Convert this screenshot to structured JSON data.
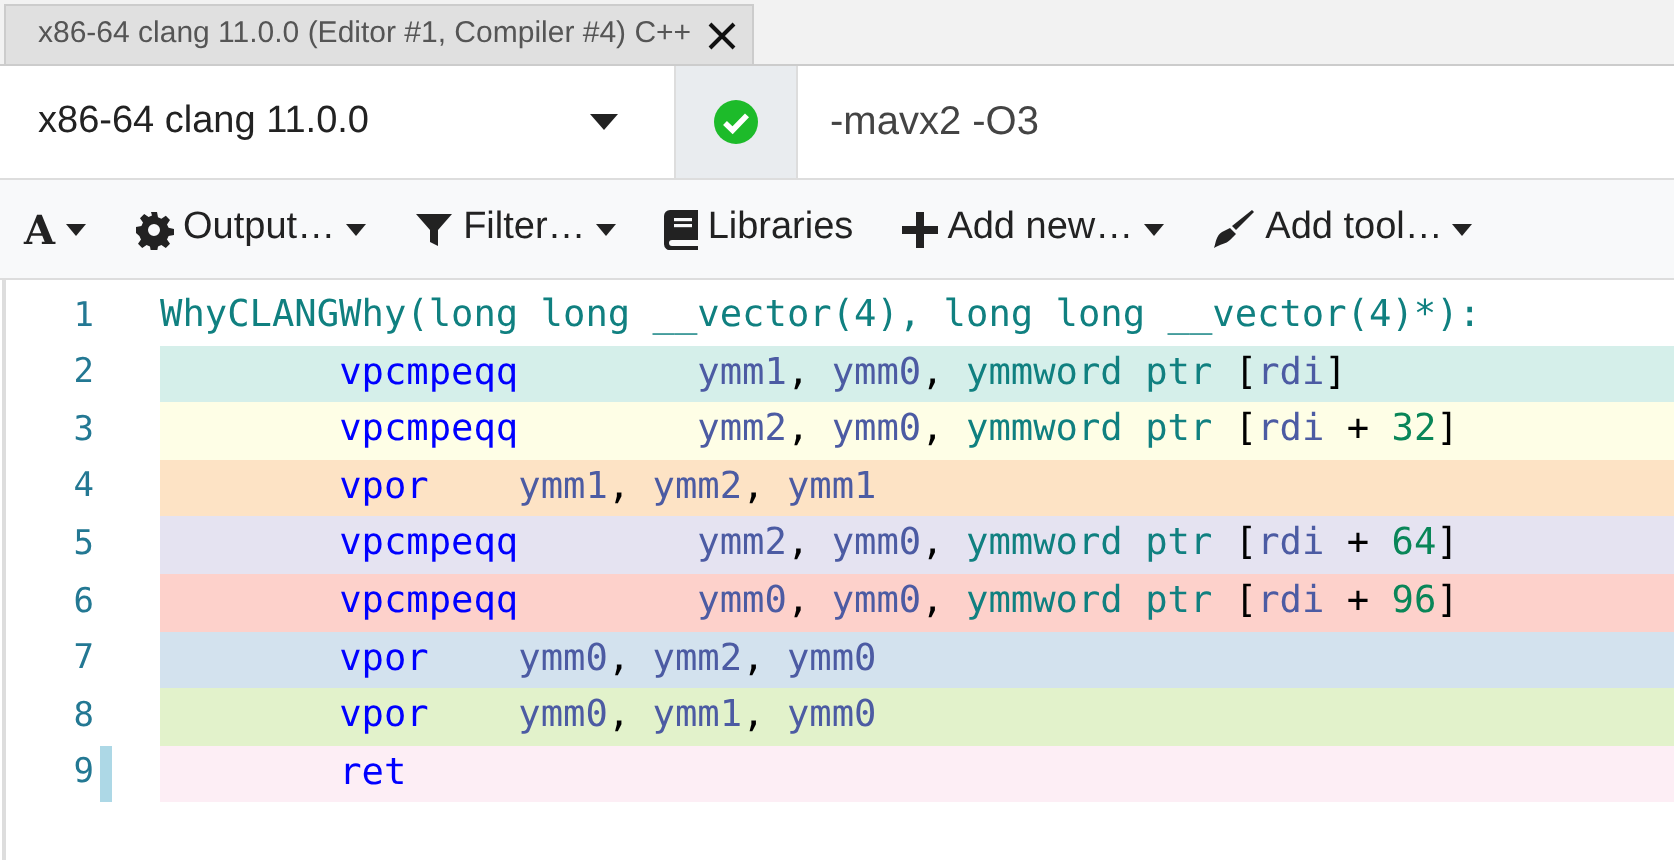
{
  "tab": {
    "title": "x86-64 clang 11.0.0 (Editor #1, Compiler #4) C++",
    "selected": true
  },
  "compiler": {
    "name": "x86-64 clang 11.0.0",
    "succeeded": true,
    "options": "-mavx2 -O3"
  },
  "toolbar": [
    {
      "kind": "font",
      "label": "A",
      "dropdown": true
    },
    {
      "kind": "output",
      "label": "Output…",
      "dropdown": true
    },
    {
      "kind": "filter",
      "label": "Filter…",
      "dropdown": true
    },
    {
      "kind": "libraries",
      "label": "Libraries",
      "dropdown": false
    },
    {
      "kind": "add",
      "label": "Add new…",
      "dropdown": true
    },
    {
      "kind": "tool",
      "label": "Add tool…",
      "dropdown": true
    }
  ],
  "lines": [
    {
      "number": "1",
      "color": "#ffffff",
      "marked": false,
      "label": "WhyCLANGWhy(long long __vector(4), long long __vector(4)*):"
    },
    {
      "number": "2",
      "color": "#d5efea",
      "marked": false,
      "mnemonic": "vpcmpeqq",
      "operands": [
        {
          "kind": "register",
          "text": "ymm1"
        },
        {
          "kind": "punct",
          "text": ", "
        },
        {
          "kind": "register",
          "text": "ymm0"
        },
        {
          "kind": "punct",
          "text": ", "
        },
        {
          "kind": "keyword",
          "text": "ymmword ptr "
        },
        {
          "kind": "punct",
          "text": "["
        },
        {
          "kind": "register",
          "text": "rdi"
        },
        {
          "kind": "punct",
          "text": "]"
        }
      ]
    },
    {
      "number": "3",
      "color": "#fefee6",
      "marked": false,
      "mnemonic": "vpcmpeqq",
      "operands": [
        {
          "kind": "register",
          "text": "ymm2"
        },
        {
          "kind": "punct",
          "text": ", "
        },
        {
          "kind": "register",
          "text": "ymm0"
        },
        {
          "kind": "punct",
          "text": ", "
        },
        {
          "kind": "keyword",
          "text": "ymmword ptr "
        },
        {
          "kind": "punct",
          "text": "["
        },
        {
          "kind": "register",
          "text": "rdi"
        },
        {
          "kind": "punct",
          "text": " + "
        },
        {
          "kind": "number",
          "text": "32"
        },
        {
          "kind": "punct",
          "text": "]"
        }
      ]
    },
    {
      "number": "4",
      "color": "#fde3c5",
      "marked": false,
      "mnemonic": "vpor",
      "operands": [
        {
          "kind": "register",
          "text": "ymm1"
        },
        {
          "kind": "punct",
          "text": ", "
        },
        {
          "kind": "register",
          "text": "ymm2"
        },
        {
          "kind": "punct",
          "text": ", "
        },
        {
          "kind": "register",
          "text": "ymm1"
        }
      ]
    },
    {
      "number": "5",
      "color": "#e5e3f1",
      "marked": false,
      "mnemonic": "vpcmpeqq",
      "operands": [
        {
          "kind": "register",
          "text": "ymm2"
        },
        {
          "kind": "punct",
          "text": ", "
        },
        {
          "kind": "register",
          "text": "ymm0"
        },
        {
          "kind": "punct",
          "text": ", "
        },
        {
          "kind": "keyword",
          "text": "ymmword ptr "
        },
        {
          "kind": "punct",
          "text": "["
        },
        {
          "kind": "register",
          "text": "rdi"
        },
        {
          "kind": "punct",
          "text": " + "
        },
        {
          "kind": "number",
          "text": "64"
        },
        {
          "kind": "punct",
          "text": "]"
        }
      ]
    },
    {
      "number": "6",
      "color": "#fdd1cb",
      "marked": false,
      "mnemonic": "vpcmpeqq",
      "operands": [
        {
          "kind": "register",
          "text": "ymm0"
        },
        {
          "kind": "punct",
          "text": ", "
        },
        {
          "kind": "register",
          "text": "ymm0"
        },
        {
          "kind": "punct",
          "text": ", "
        },
        {
          "kind": "keyword",
          "text": "ymmword ptr "
        },
        {
          "kind": "punct",
          "text": "["
        },
        {
          "kind": "register",
          "text": "rdi"
        },
        {
          "kind": "punct",
          "text": " + "
        },
        {
          "kind": "number",
          "text": "96"
        },
        {
          "kind": "punct",
          "text": "]"
        }
      ]
    },
    {
      "number": "7",
      "color": "#d3e2ee",
      "marked": false,
      "mnemonic": "vpor",
      "operands": [
        {
          "kind": "register",
          "text": "ymm0"
        },
        {
          "kind": "punct",
          "text": ", "
        },
        {
          "kind": "register",
          "text": "ymm2"
        },
        {
          "kind": "punct",
          "text": ", "
        },
        {
          "kind": "register",
          "text": "ymm0"
        }
      ]
    },
    {
      "number": "8",
      "color": "#e2f2cb",
      "marked": false,
      "mnemonic": "vpor",
      "operands": [
        {
          "kind": "register",
          "text": "ymm0"
        },
        {
          "kind": "punct",
          "text": ", "
        },
        {
          "kind": "register",
          "text": "ymm1"
        },
        {
          "kind": "punct",
          "text": ", "
        },
        {
          "kind": "register",
          "text": "ymm0"
        }
      ]
    },
    {
      "number": "9",
      "color": "#fdeef5",
      "marked": true,
      "mnemonic": "ret"
    }
  ]
}
